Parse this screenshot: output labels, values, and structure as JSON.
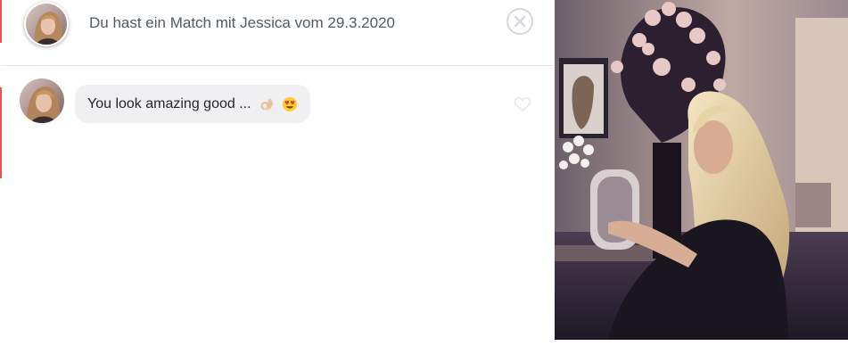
{
  "header": {
    "match_text": "Du hast ein Match mit Jessica vom 29.3.2020",
    "close_icon": "close-icon",
    "avatar_icon": "avatar"
  },
  "messages": [
    {
      "text": "You look amazing good ...",
      "emojis": [
        "ok-hand-emoji",
        "heart-eyes-emoji"
      ],
      "like_icon": "heart-outline-icon"
    }
  ],
  "profile_photo": {
    "description_icon": "profile-photo"
  },
  "colors": {
    "accent": "#e8534a",
    "text": "#505965",
    "bubble": "#f0f0f2",
    "border": "#e6e6e6"
  }
}
